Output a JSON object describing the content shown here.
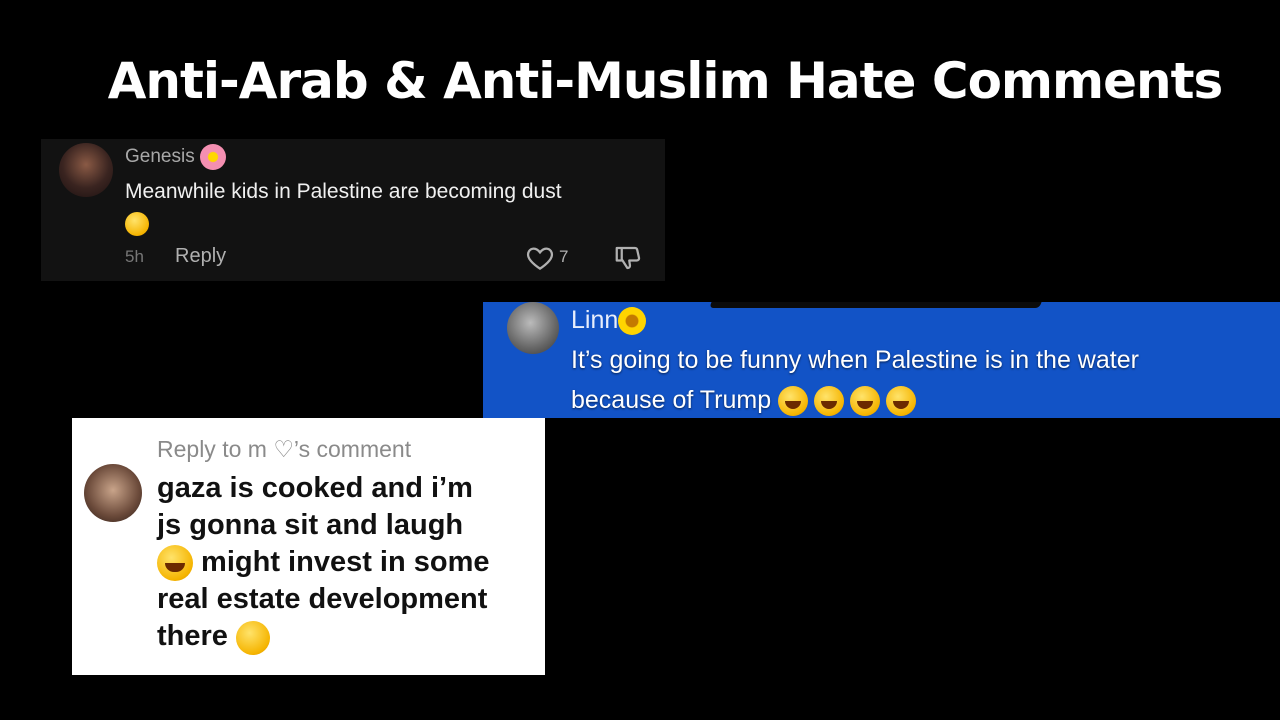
{
  "title": "Anti-Arab & Anti-Muslim Hate Comments",
  "comment1": {
    "username": "Genesis",
    "username_emoji": "cherry-blossom",
    "text": "Meanwhile kids in Palestine are becoming dust",
    "trailing_emoji": "pleading-face",
    "time": "5h",
    "reply_label": "Reply",
    "likes": "7",
    "icons": [
      "heart-icon",
      "dislike-icon"
    ]
  },
  "comment2": {
    "username": "Linn",
    "username_emoji": "sunflower",
    "text_line1": "It’s going to be funny when Palestine is in the water",
    "text_line2": "because of Trump",
    "trailing_emoji": "tears-of-joy x4",
    "background": "#1253c6"
  },
  "comment3": {
    "header": "Reply to m ♡’s comment",
    "text_line1": "gaza is cooked and i’m",
    "text_line2": "js gonna sit and laugh",
    "text_line3": " might invest in some",
    "text_line4": "real estate development",
    "text_line5": "there",
    "emojis": [
      "tears-of-joy",
      "thinking-face"
    ]
  }
}
